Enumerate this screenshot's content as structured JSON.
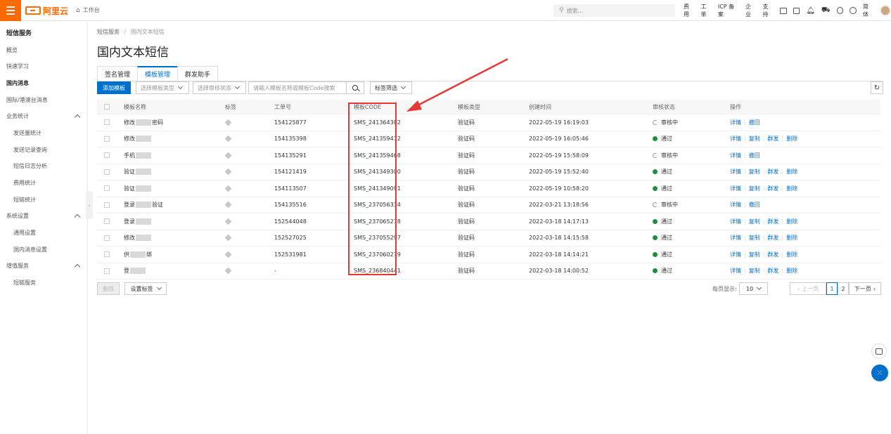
{
  "topbar": {
    "logo_text": "阿里云",
    "workbench": "工作台",
    "search_placeholder": "搜索...",
    "nav": [
      "费用",
      "工单",
      "ICP 备案",
      "企业",
      "支持"
    ],
    "lang": "简体"
  },
  "sidebar": {
    "title": "短信服务",
    "items": [
      {
        "label": "概览"
      },
      {
        "label": "快速学习"
      },
      {
        "label": "国内消息"
      },
      {
        "label": "国际/港澳台消息"
      },
      {
        "label": "业务统计"
      },
      {
        "label": "发送量统计"
      },
      {
        "label": "发送记录查询"
      },
      {
        "label": "短信日志分析"
      },
      {
        "label": "费用统计"
      },
      {
        "label": "短链统计"
      },
      {
        "label": "系统设置"
      },
      {
        "label": "通用设置"
      },
      {
        "label": "国内消息设置"
      },
      {
        "label": "增值服务"
      },
      {
        "label": "短链服务"
      }
    ]
  },
  "breadcrumb": {
    "root": "短信服务",
    "sep": "/",
    "current": "国内文本短信"
  },
  "page_title": "国内文本短信",
  "tabs": [
    "签名管理",
    "模板管理",
    "群发助手"
  ],
  "toolbar": {
    "add_label": "添加模板",
    "type_select": "选择模板类型",
    "status_select": "选择审核状态",
    "search_placeholder": "请输入模板名称或模板Code搜索",
    "tag_filter": "标签筛选"
  },
  "table": {
    "headers": [
      "模板名称",
      "标签",
      "工单号",
      "模板CODE",
      "模板类型",
      "创建时间",
      "审核状态",
      "操作"
    ],
    "rows": [
      {
        "name_a": "修改",
        "name_b": "密码",
        "ticket": "154125877",
        "code": "SMS_241364382",
        "type": "验证码",
        "created": "2022-05-19 16:19:03",
        "status": "审核中",
        "ok": false
      },
      {
        "name_a": "修改",
        "name_b": "",
        "ticket": "154135398",
        "code": "SMS_241359472",
        "type": "验证码",
        "created": "2022-05-19 16:05:46",
        "status": "通过",
        "ok": true
      },
      {
        "name_a": "手机",
        "name_b": "",
        "ticket": "154135291",
        "code": "SMS_241359468",
        "type": "验证码",
        "created": "2022-05-19 15:58:09",
        "status": "审核中",
        "ok": false
      },
      {
        "name_a": "验证",
        "name_b": "",
        "ticket": "154121419",
        "code": "SMS_241349300",
        "type": "验证码",
        "created": "2022-05-19 15:52:40",
        "status": "通过",
        "ok": true
      },
      {
        "name_a": "验证",
        "name_b": "",
        "ticket": "154113507",
        "code": "SMS_241349091",
        "type": "验证码",
        "created": "2022-05-19 10:58:20",
        "status": "通过",
        "ok": true
      },
      {
        "name_a": "登录",
        "name_b": "验证",
        "ticket": "154135516",
        "code": "SMS_237056334",
        "type": "验证码",
        "created": "2022-03-21 13:18:56",
        "status": "审核中",
        "ok": false
      },
      {
        "name_a": "登录",
        "name_b": "",
        "ticket": "152544048",
        "code": "SMS_237065278",
        "type": "验证码",
        "created": "2022-03-18 14:17:13",
        "status": "通过",
        "ok": true
      },
      {
        "name_a": "修改",
        "name_b": "",
        "ticket": "152527025",
        "code": "SMS_237055297",
        "type": "验证码",
        "created": "2022-03-18 14:15:58",
        "status": "通过",
        "ok": true
      },
      {
        "name_a": "供",
        "name_b": "绑",
        "ticket": "152531981",
        "code": "SMS_237060279",
        "type": "验证码",
        "created": "2022-03-18 14:14:21",
        "status": "通过",
        "ok": true
      },
      {
        "name_a": "登",
        "name_b": "",
        "ticket": "-",
        "code": "SMS_236840441",
        "type": "验证码",
        "created": "2022-03-18 14:00:52",
        "status": "通过",
        "ok": true
      }
    ],
    "ops": {
      "detail": "详情",
      "revoke": "撤回",
      "copy": "复制",
      "mass": "群发",
      "delete": "删除"
    }
  },
  "footer": {
    "delete_btn": "删除",
    "set_tag": "设置标签",
    "per_page_label": "每页显示:",
    "per_page": "10",
    "prev": "上一页",
    "pages": [
      "1",
      "2"
    ],
    "next": "下一页"
  },
  "colors": {
    "brand": "#ff6a00",
    "primary": "#0070cc",
    "highlight": "#e53935",
    "ok": "#1e8e3e"
  }
}
